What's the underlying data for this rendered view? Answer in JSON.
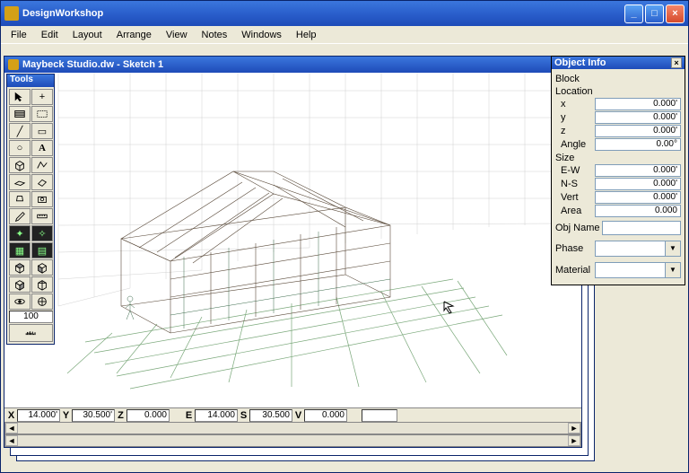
{
  "app": {
    "title": "DesignWorkshop"
  },
  "menu": [
    "File",
    "Edit",
    "Layout",
    "Arrange",
    "View",
    "Notes",
    "Windows",
    "Help"
  ],
  "doc": {
    "title": "Maybeck Studio.dw - Sketch 1"
  },
  "tools": {
    "title": "Tools",
    "number": "100"
  },
  "coords": {
    "X": "14.000'",
    "Y": "30.500'",
    "Z": "0.000",
    "E": "14.000",
    "S": "30.500",
    "V": "0.000"
  },
  "objinfo": {
    "title": "Object Info",
    "block": "Block",
    "location": "Location",
    "x_lbl": "x",
    "x_val": "0.000'",
    "y_lbl": "y",
    "y_val": "0.000'",
    "z_lbl": "z",
    "z_val": "0.000'",
    "angle_lbl": "Angle",
    "angle_val": "0.00°",
    "size": "Size",
    "ew_lbl": "E-W",
    "ew_val": "0.000'",
    "ns_lbl": "N-S",
    "ns_val": "0.000'",
    "vert_lbl": "Vert",
    "vert_val": "0.000'",
    "area_lbl": "Area",
    "area_val": "0.000",
    "objname_lbl": "Obj Name",
    "phase_lbl": "Phase",
    "material_lbl": "Material"
  }
}
